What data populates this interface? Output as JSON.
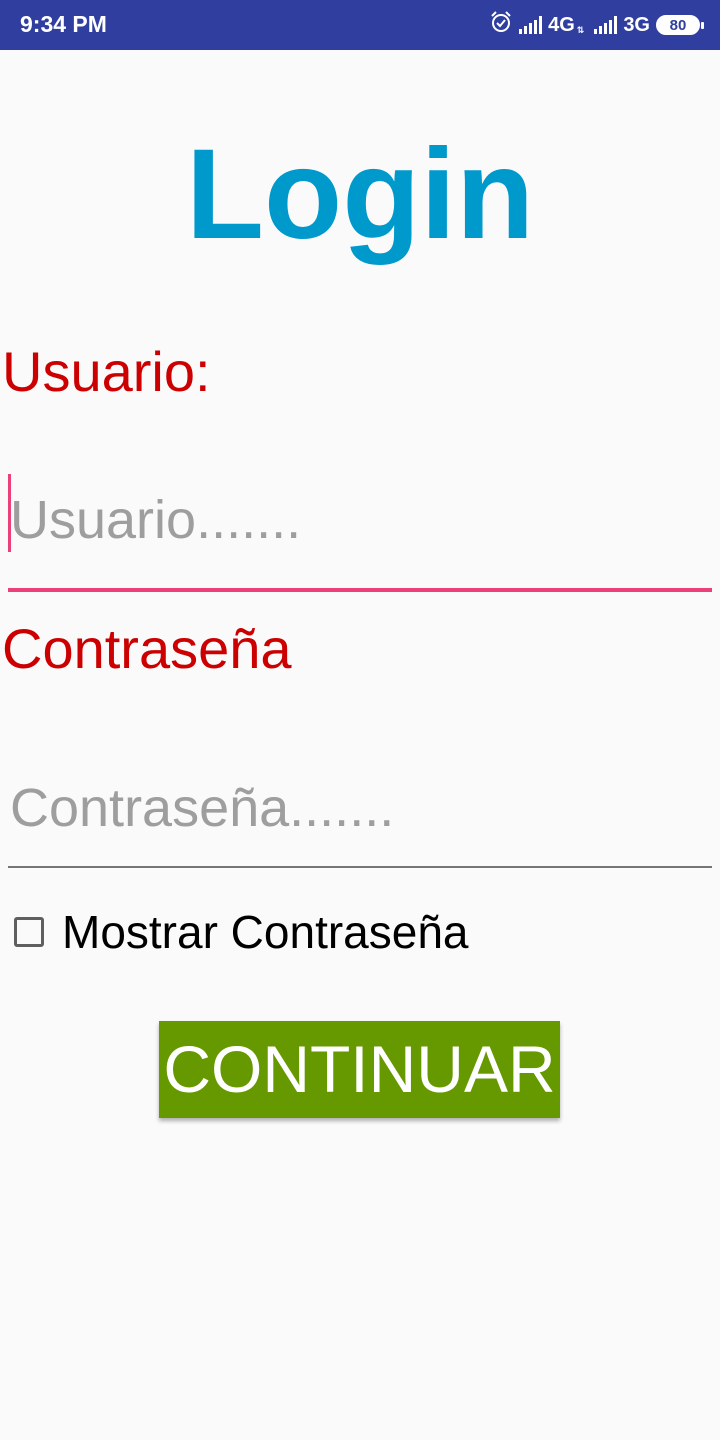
{
  "status_bar": {
    "time": "9:34 PM",
    "network_1": "4G",
    "network_1_sub": "⇅",
    "network_2": "3G",
    "battery": "80",
    "background_color": "#303f9f",
    "icons": [
      "alarm-icon",
      "signal-icon",
      "signal-icon",
      "battery-icon"
    ]
  },
  "page": {
    "title": "Login",
    "title_color": "#0099cc"
  },
  "form": {
    "username_label": "Usuario:",
    "username_placeholder": "Usuario.......",
    "username_value": "",
    "password_label": "Contraseña",
    "password_placeholder": "Contraseña.......",
    "password_value": "",
    "show_password_label": "Mostrar Contraseña",
    "show_password_checked": false,
    "label_color": "#cc0000",
    "focus_color": "#ec407a"
  },
  "actions": {
    "continue_label": "CONTINUAR",
    "continue_color": "#669900"
  }
}
